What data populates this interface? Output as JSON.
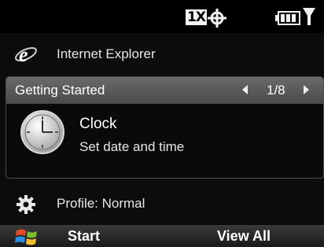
{
  "status_bar": {
    "network_label": "1X",
    "icons": [
      "gps-icon",
      "battery-icon",
      "signal-icon"
    ]
  },
  "today": {
    "internet_explorer": {
      "icon": "internet-explorer-icon",
      "label": "Internet Explorer"
    },
    "getting_started": {
      "title": "Getting Started",
      "page_counter": "1/8",
      "item": {
        "icon": "clock-icon",
        "title": "Clock",
        "subtitle": "Set date and time"
      }
    },
    "profile": {
      "icon": "gear-icon",
      "label": "Profile: Normal"
    }
  },
  "softkeys": {
    "start_icon": "windows-flag-icon",
    "left": "Start",
    "right": "View All"
  },
  "colors": {
    "background": "#0c0c0c",
    "panel_header": "#5a5a5a",
    "text": "#e6e6e6",
    "ie_blue": "#2d7fd6"
  }
}
